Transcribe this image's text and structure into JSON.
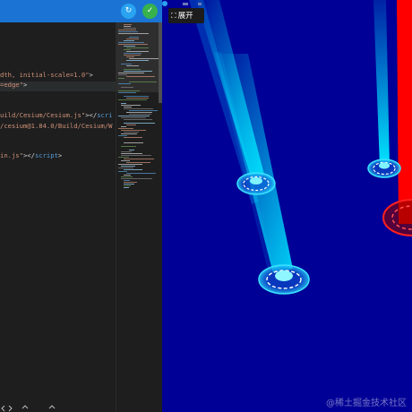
{
  "toolbar": {
    "refresh_icon": "refresh-icon",
    "run_icon": "check-icon",
    "refresh_glyph": "↻",
    "run_glyph": "✓"
  },
  "editor": {
    "lines": [
      {
        "parts": [
          {
            "t": "dth, initial-scale=1.0\"",
            "c": "str"
          },
          {
            "t": ">",
            "c": "txt"
          }
        ]
      },
      {
        "parts": [
          {
            "t": "=edge\"",
            "c": "str"
          },
          {
            "t": ">",
            "c": "txt"
          }
        ]
      },
      {
        "parts": [
          {
            "t": "uild/Cesium/Cesium.js\"",
            "c": "str"
          },
          {
            "t": "></",
            "c": "txt"
          },
          {
            "t": "scri",
            "c": "tag"
          }
        ]
      },
      {
        "parts": [
          {
            "t": "/cesium@1.84.0/Build/Cesium/W",
            "c": "str"
          }
        ]
      },
      {
        "parts": [
          {
            "t": "in.js\"",
            "c": "str"
          },
          {
            "t": "></",
            "c": "txt"
          },
          {
            "t": "script",
            "c": "tag"
          },
          {
            "t": ">",
            "c": "txt"
          }
        ]
      }
    ]
  },
  "viewer": {
    "expand_label": "展开",
    "expand_icon": "expand-icon",
    "watermark": "@稀土掘金技术社区",
    "colors": {
      "background": "#000096",
      "beam_cyan": "#00e5ff",
      "beam_red": "#ff0000"
    }
  }
}
